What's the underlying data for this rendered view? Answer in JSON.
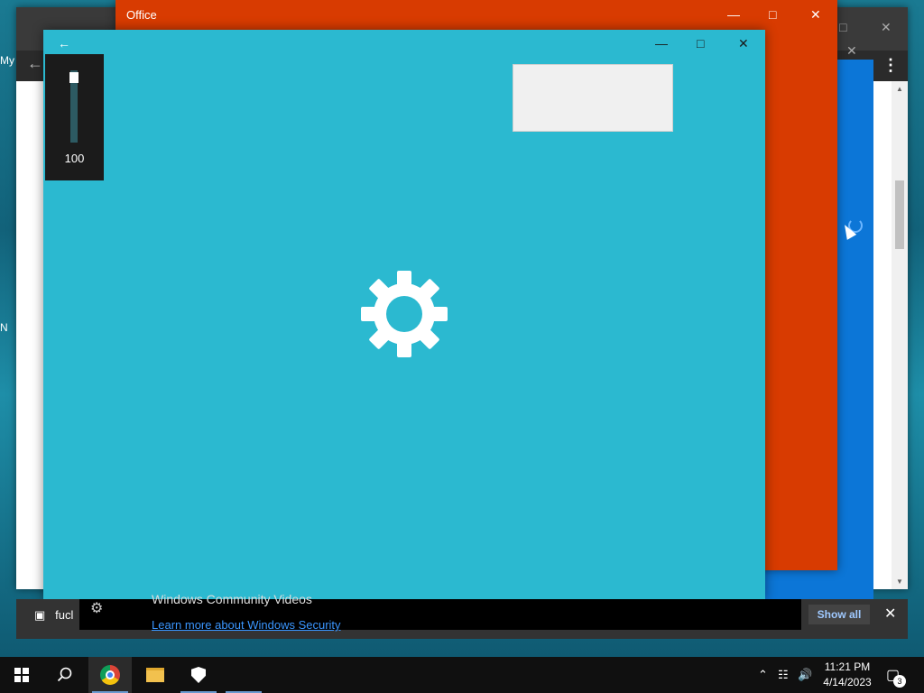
{
  "office_window": {
    "title": "Office"
  },
  "main_window": {
    "volume": {
      "level": "100",
      "level_percent": 100
    }
  },
  "side_letters": [
    "My",
    "N"
  ],
  "notification": {
    "file_label": "fucl",
    "title": "Windows Community Videos",
    "link": "Learn more about Windows Security",
    "show_all": "Show all"
  },
  "taskbar": {
    "items": [
      "start-icon",
      "search-icon",
      "chrome-icon",
      "file-explorer-icon",
      "windows-security-icon"
    ],
    "clock": {
      "time": "11:21 PM",
      "date": "4/14/2023"
    },
    "notification_count": "3"
  },
  "colors": {
    "office": "#d83b01",
    "main_window": "#2bb9d0",
    "blue_app": "#0c76d7",
    "link": "#3a96ff"
  }
}
